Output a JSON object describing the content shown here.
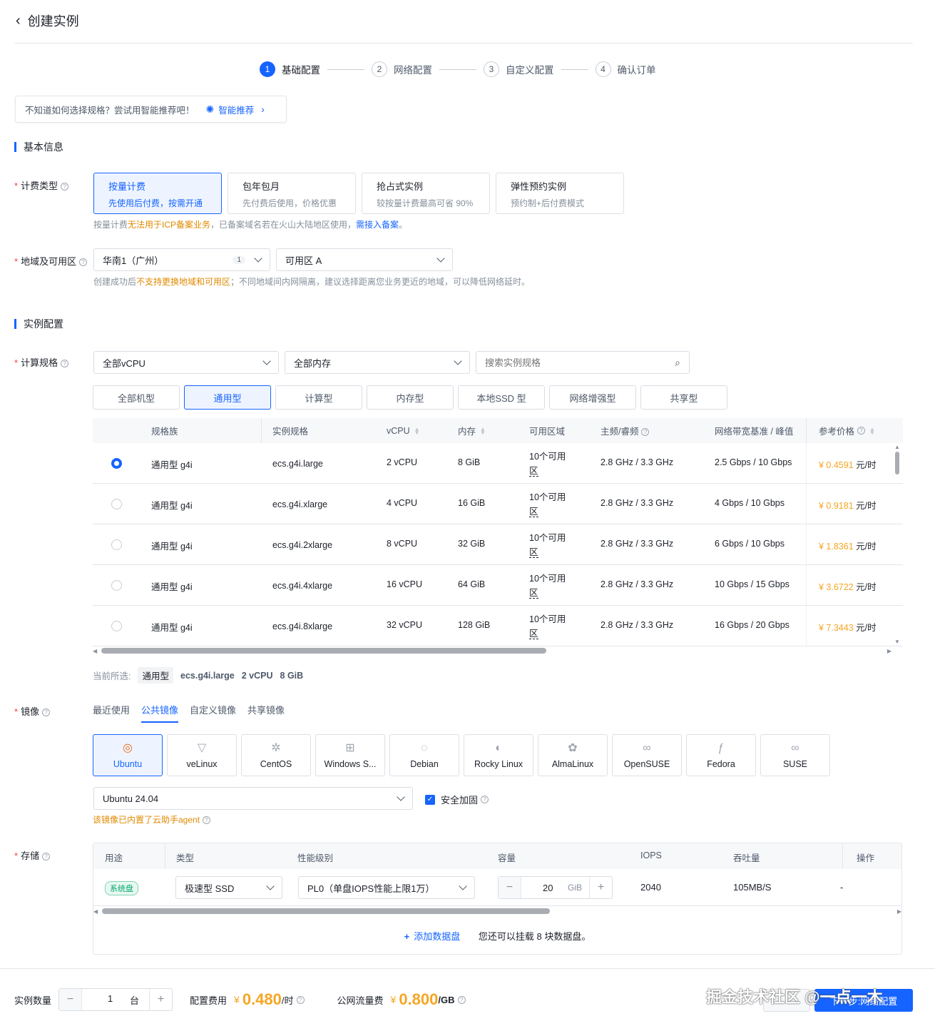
{
  "header": {
    "back_label": "‹",
    "title": "创建实例"
  },
  "steps": [
    {
      "num": "1",
      "label": "基础配置",
      "active": true
    },
    {
      "num": "2",
      "label": "网络配置",
      "active": false
    },
    {
      "num": "3",
      "label": "自定义配置",
      "active": false
    },
    {
      "num": "4",
      "label": "确认订单",
      "active": false
    }
  ],
  "tip": {
    "text": "不知道如何选择规格？尝试用智能推荐吧！",
    "link": "智能推荐"
  },
  "basic": {
    "section_title": "基本信息",
    "billing_label": "计费类型",
    "billing_options": [
      {
        "title": "按量计费",
        "desc": "先使用后付费，按需开通"
      },
      {
        "title": "包年包月",
        "desc": "先付费后使用，价格优惠"
      },
      {
        "title": "抢占式实例",
        "desc": "较按量计费最高可省 90%"
      },
      {
        "title": "弹性预约实例",
        "desc": "预约制+后付费模式"
      }
    ],
    "billing_note_1": "按量计费",
    "billing_note_2": "无法用于ICP备案业务",
    "billing_note_3": "，已备案域名若在火山大陆地区使用，",
    "billing_note_4": "需接入备案",
    "billing_note_5": "。",
    "region_label": "地域及可用区",
    "region_value": "华南1（广州）",
    "region_badge": "1",
    "zone_value": "可用区 A",
    "region_note_1": "创建成功后",
    "region_note_2": "不支持更换地域和可用区",
    "region_note_3": "；不同地域间内网隔离，建议选择距离您业务更近的地域，可以降低网络延时。"
  },
  "instance": {
    "section_title": "实例配置",
    "spec_label": "计算规格",
    "vcpu_filter": "全部vCPU",
    "mem_filter": "全部内存",
    "search_placeholder": "搜索实例规格",
    "family_tabs": [
      "全部机型",
      "通用型",
      "计算型",
      "内存型",
      "本地SSD 型",
      "网络增强型",
      "共享型"
    ],
    "columns": [
      "规格族",
      "实例规格",
      "vCPU",
      "内存",
      "可用区域",
      "主频/睿频",
      "网络带宽基准 / 峰值",
      "参考价格"
    ],
    "rows": [
      {
        "family": "通用型 g4i",
        "spec": "ecs.g4i.large",
        "vcpu": "2 vCPU",
        "mem": "8 GiB",
        "zone_a": "10个可用",
        "zone_b": "区",
        "freq": "2.8 GHz / 3.3 GHz",
        "bw": "2.5 Gbps / 10 Gbps",
        "price": "¥ 0.4591",
        "unit": "元/时",
        "selected": true
      },
      {
        "family": "通用型 g4i",
        "spec": "ecs.g4i.xlarge",
        "vcpu": "4 vCPU",
        "mem": "16 GiB",
        "zone_a": "10个可用",
        "zone_b": "区",
        "freq": "2.8 GHz / 3.3 GHz",
        "bw": "4 Gbps / 10 Gbps",
        "price": "¥ 0.9181",
        "unit": "元/时",
        "selected": false
      },
      {
        "family": "通用型 g4i",
        "spec": "ecs.g4i.2xlarge",
        "vcpu": "8 vCPU",
        "mem": "32 GiB",
        "zone_a": "10个可用",
        "zone_b": "区",
        "freq": "2.8 GHz / 3.3 GHz",
        "bw": "6 Gbps / 10 Gbps",
        "price": "¥ 1.8361",
        "unit": "元/时",
        "selected": false
      },
      {
        "family": "通用型 g4i",
        "spec": "ecs.g4i.4xlarge",
        "vcpu": "16 vCPU",
        "mem": "64 GiB",
        "zone_a": "10个可用",
        "zone_b": "区",
        "freq": "2.8 GHz / 3.3 GHz",
        "bw": "10 Gbps / 15 Gbps",
        "price": "¥ 3.6722",
        "unit": "元/时",
        "selected": false
      },
      {
        "family": "通用型 g4i",
        "spec": "ecs.g4i.8xlarge",
        "vcpu": "32 vCPU",
        "mem": "128 GiB",
        "zone_a": "10个可用",
        "zone_b": "区",
        "freq": "2.8 GHz / 3.3 GHz",
        "bw": "16 Gbps / 20 Gbps",
        "price": "¥ 7.3443",
        "unit": "元/时",
        "selected": false
      }
    ],
    "current_label": "当前所选:",
    "current_tag": "通用型",
    "current_spec": "ecs.g4i.large",
    "current_vcpu": "2 vCPU",
    "current_mem": "8 GiB"
  },
  "image": {
    "label": "镜像",
    "tabs": [
      "最近使用",
      "公共镜像",
      "自定义镜像",
      "共享镜像"
    ],
    "active_tab": 1,
    "os_list": [
      {
        "name": "Ubuntu",
        "icon": "ubuntu-icon",
        "glyph": "◎"
      },
      {
        "name": "veLinux",
        "icon": "velinux-icon",
        "glyph": "▽"
      },
      {
        "name": "CentOS",
        "icon": "centos-icon",
        "glyph": "✲"
      },
      {
        "name": "Windows S...",
        "icon": "windows-icon",
        "glyph": "⊞"
      },
      {
        "name": "Debian",
        "icon": "debian-icon",
        "glyph": "◌"
      },
      {
        "name": "Rocky Linux",
        "icon": "rocky-linux-icon",
        "glyph": "◐"
      },
      {
        "name": "AlmaLinux",
        "icon": "almalinux-icon",
        "glyph": "✿"
      },
      {
        "name": "OpenSUSE",
        "icon": "opensuse-icon",
        "glyph": "∞"
      },
      {
        "name": "Fedora",
        "icon": "fedora-icon",
        "glyph": "ƒ"
      },
      {
        "name": "SUSE",
        "icon": "suse-icon",
        "glyph": "∞"
      }
    ],
    "version": "Ubuntu 24.04",
    "security_label": "安全加固",
    "agent_note": "该镜像已内置了云助手agent"
  },
  "storage": {
    "label": "存储",
    "columns": [
      "用途",
      "类型",
      "性能级别",
      "容量",
      "IOPS",
      "吞吐量",
      "操作"
    ],
    "disk_tag": "系统盘",
    "disk_type": "极速型 SSD",
    "perf_level": "PL0（单盘IOPS性能上限1万）",
    "capacity": "20",
    "capacity_unit": "GiB",
    "iops": "2040",
    "throughput": "105MB/S",
    "extra": "-",
    "add_label": "添加数据盘",
    "add_note": "您还可以挂载 8 块数据盘。"
  },
  "footer": {
    "count_label": "实例数量",
    "count_value": "1",
    "count_unit": "台",
    "config_fee_label": "配置费用",
    "config_fee_symbol": "¥",
    "config_fee_value": "0.480",
    "config_fee_unit": "/时",
    "traffic_fee_label": "公网流量费",
    "traffic_fee_symbol": "¥",
    "traffic_fee_value": "0.800",
    "traffic_fee_unit": "/GB",
    "next_label": "下一步:网络配置",
    "watermark": "掘金技术社区 @一点一木"
  },
  "colors": {
    "primary": "#1664ff",
    "price": "#f5a623",
    "warning": "#e08a00",
    "required": "#f53f3f"
  }
}
